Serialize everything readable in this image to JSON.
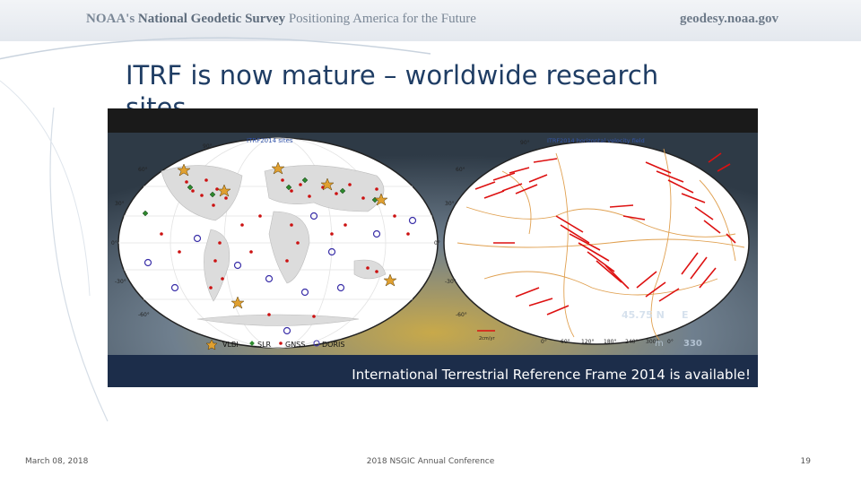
{
  "header": {
    "org_prefix": "NOAA's",
    "org_name": "National Geodetic Survey",
    "tagline": "Positioning America for the Future",
    "site": "geodesy.noaa.gov"
  },
  "slide": {
    "title": "ITRF is now mature – worldwide research sites"
  },
  "figure": {
    "left_map_title": "ITRF2014 sites",
    "right_map_title": "ITRF2014 horizontal velocity field",
    "legend": [
      "VLBI",
      "SLR",
      "GNSS",
      "DORIS"
    ],
    "caption": "International Terrestrial Reference Frame 2014 is available!",
    "lat_labels": [
      "90°",
      "60°",
      "30°",
      "0°",
      "-30°",
      "-60°",
      "-90°"
    ],
    "lon_labels": [
      "0°",
      "60°",
      "120°",
      "180°",
      "240°",
      "300°",
      "0°"
    ],
    "overlay_readout": "45.75 N",
    "overlay_readout2": "E",
    "overlay_number": "330",
    "overlay_unit": "m",
    "scale_label": "2cm/yr"
  },
  "footer": {
    "date": "March 08, 2018",
    "conference": "2018 NSGIC Annual Conference",
    "page": "19"
  }
}
